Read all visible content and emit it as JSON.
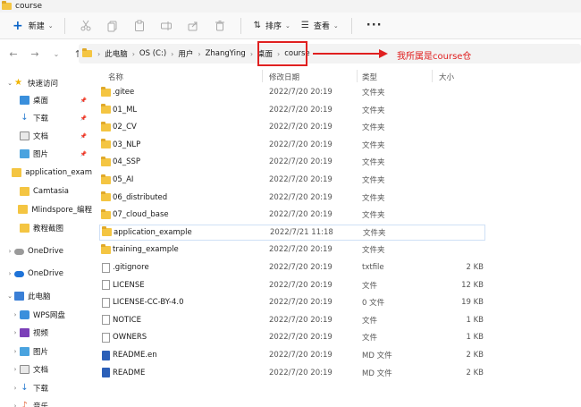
{
  "window": {
    "title": "course"
  },
  "toolbar": {
    "new_label": "新建",
    "sort_label": "排序",
    "view_label": "查看"
  },
  "breadcrumb": [
    "此电脑",
    "OS (C:)",
    "用户",
    "ZhangYing",
    "桌面"
  ],
  "current_folder": "course",
  "annotation": {
    "text": "我所属是course仓",
    "color": "#e02020"
  },
  "columns": {
    "name": "名称",
    "date": "修改日期",
    "type": "类型",
    "size": "大小"
  },
  "sidebar": {
    "items": [
      {
        "label": "快速访问",
        "icon": "star-icon",
        "expand": "⌄",
        "indent": 0,
        "pin": false
      },
      {
        "label": "桌面",
        "icon": "desktop-icon",
        "expand": "",
        "indent": 1,
        "pin": true
      },
      {
        "label": "下载",
        "icon": "download-icon",
        "expand": "",
        "indent": 1,
        "pin": true
      },
      {
        "label": "文档",
        "icon": "document-icon",
        "expand": "",
        "indent": 1,
        "pin": true
      },
      {
        "label": "图片",
        "icon": "pictures-icon",
        "expand": "",
        "indent": 1,
        "pin": true
      },
      {
        "label": "application_exam",
        "icon": "folder-icon",
        "expand": "",
        "indent": 1,
        "pin": false
      },
      {
        "label": "Camtasia",
        "icon": "folder-icon",
        "expand": "",
        "indent": 1,
        "pin": false
      },
      {
        "label": "Mlindspore_编程",
        "icon": "folder-icon",
        "expand": "",
        "indent": 1,
        "pin": false
      },
      {
        "label": "教程截图",
        "icon": "folder-icon",
        "expand": "",
        "indent": 1,
        "pin": false
      },
      {
        "label": "OneDrive",
        "icon": "cloud-icon",
        "expand": "›",
        "indent": 0,
        "pin": false
      },
      {
        "label": "OneDrive",
        "icon": "cloud-blue-icon",
        "expand": "›",
        "indent": 0,
        "pin": false
      },
      {
        "label": "此电脑",
        "icon": "computer-icon",
        "expand": "⌄",
        "indent": 0,
        "pin": false
      },
      {
        "label": "WPS网盘",
        "icon": "wps-icon",
        "expand": "›",
        "indent": 1,
        "pin": false
      },
      {
        "label": "视频",
        "icon": "video-icon",
        "expand": "›",
        "indent": 1,
        "pin": false
      },
      {
        "label": "图片",
        "icon": "pictures-icon",
        "expand": "›",
        "indent": 1,
        "pin": false
      },
      {
        "label": "文档",
        "icon": "document-icon",
        "expand": "›",
        "indent": 1,
        "pin": false
      },
      {
        "label": "下载",
        "icon": "download-icon",
        "expand": "›",
        "indent": 1,
        "pin": false
      },
      {
        "label": "音乐",
        "icon": "music-icon",
        "expand": "›",
        "indent": 1,
        "pin": false
      }
    ]
  },
  "files": [
    {
      "name": ".gitee",
      "date": "2022/7/20 20:19",
      "type": "文件夹",
      "size": "",
      "icon": "folder-icon"
    },
    {
      "name": "01_ML",
      "date": "2022/7/20 20:19",
      "type": "文件夹",
      "size": "",
      "icon": "folder-icon"
    },
    {
      "name": "02_CV",
      "date": "2022/7/20 20:19",
      "type": "文件夹",
      "size": "",
      "icon": "folder-icon"
    },
    {
      "name": "03_NLP",
      "date": "2022/7/20 20:19",
      "type": "文件夹",
      "size": "",
      "icon": "folder-icon"
    },
    {
      "name": "04_SSP",
      "date": "2022/7/20 20:19",
      "type": "文件夹",
      "size": "",
      "icon": "folder-icon"
    },
    {
      "name": "05_AI",
      "date": "2022/7/20 20:19",
      "type": "文件夹",
      "size": "",
      "icon": "folder-icon"
    },
    {
      "name": "06_distributed",
      "date": "2022/7/20 20:19",
      "type": "文件夹",
      "size": "",
      "icon": "folder-icon"
    },
    {
      "name": "07_cloud_base",
      "date": "2022/7/20 20:19",
      "type": "文件夹",
      "size": "",
      "icon": "folder-icon"
    },
    {
      "name": "application_example",
      "date": "2022/7/21 11:18",
      "type": "文件夹",
      "size": "",
      "icon": "folder-icon",
      "selected": true
    },
    {
      "name": "training_example",
      "date": "2022/7/20 20:19",
      "type": "文件夹",
      "size": "",
      "icon": "folder-icon"
    },
    {
      "name": ".gitignore",
      "date": "2022/7/20 20:19",
      "type": "txtfile",
      "size": "2 KB",
      "icon": "file-icon"
    },
    {
      "name": "LICENSE",
      "date": "2022/7/20 20:19",
      "type": "文件",
      "size": "12 KB",
      "icon": "file-icon"
    },
    {
      "name": "LICENSE-CC-BY-4.0",
      "date": "2022/7/20 20:19",
      "type": "0 文件",
      "size": "19 KB",
      "icon": "file-icon"
    },
    {
      "name": "NOTICE",
      "date": "2022/7/20 20:19",
      "type": "文件",
      "size": "1 KB",
      "icon": "file-icon"
    },
    {
      "name": "OWNERS",
      "date": "2022/7/20 20:19",
      "type": "文件",
      "size": "1 KB",
      "icon": "file-icon"
    },
    {
      "name": "README.en",
      "date": "2022/7/20 20:19",
      "type": "MD 文件",
      "size": "2 KB",
      "icon": "word-icon"
    },
    {
      "name": "README",
      "date": "2022/7/20 20:19",
      "type": "MD 文件",
      "size": "2 KB",
      "icon": "word-icon"
    }
  ]
}
